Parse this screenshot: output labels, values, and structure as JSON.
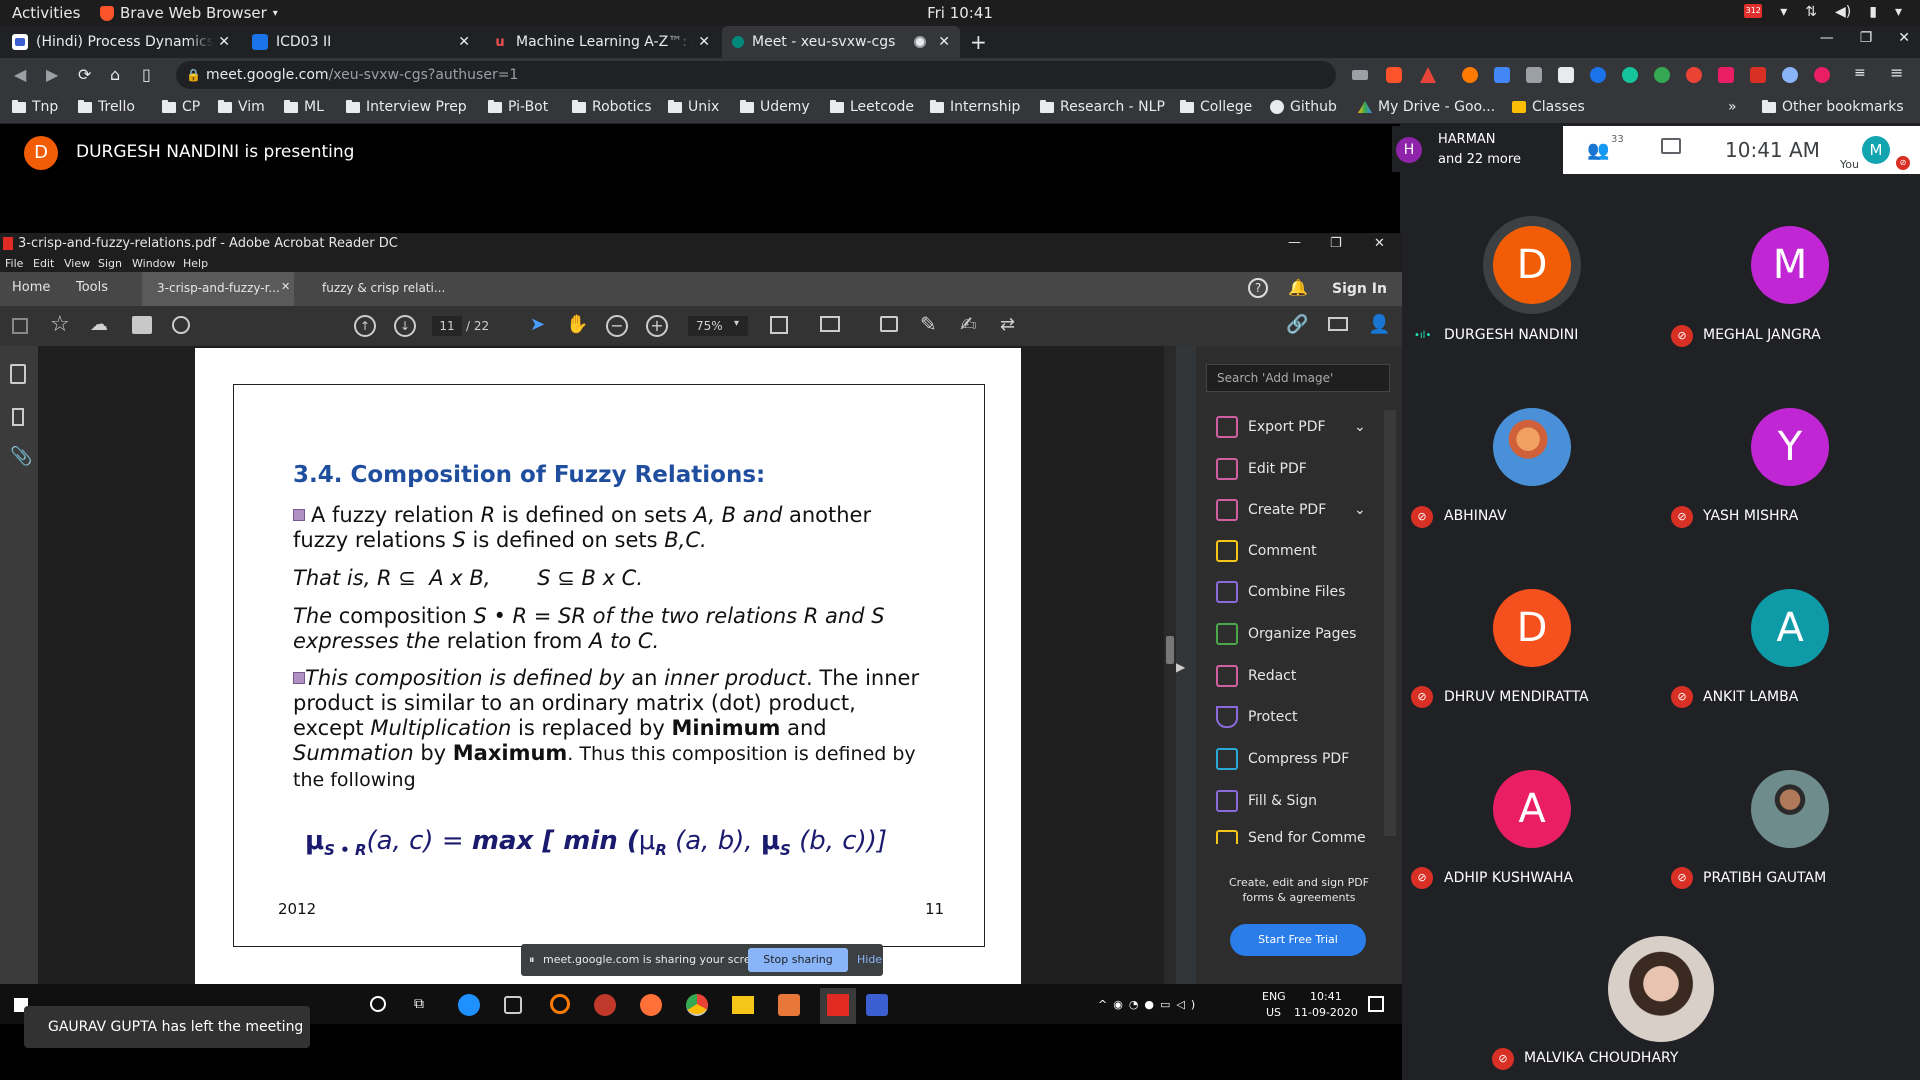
{
  "gnome": {
    "activities": "Activities",
    "app_name": "Brave Web Browser",
    "clock": "Fri 10:41",
    "badge": "312"
  },
  "browser": {
    "tabs": [
      {
        "title": "(Hindi) Process Dynamics a",
        "fav_color": "#2b579a"
      },
      {
        "title": "ICD03 II",
        "fav_color": "#1a73e8"
      },
      {
        "title": "Machine Learning A-Z™: Ha",
        "fav_color": "#a435f0"
      },
      {
        "title": "Meet - xeu-svxw-cgs",
        "fav_color": "#00897b"
      }
    ],
    "new_tab": "+",
    "url_host": "meet.google.com",
    "url_path": "/xeu-svxw-cgs?authuser=1",
    "bookmarks": [
      "Tnp",
      "Trello",
      "CP",
      "Vim",
      "ML",
      "Interview Prep",
      "Pi-Bot",
      "Robotics",
      "Unix",
      "Udemy",
      "Leetcode",
      "Internship",
      "Research - NLP",
      "College",
      "Github",
      "My Drive - Goo...",
      "Classes"
    ],
    "other_bookmarks": "Other bookmarks",
    "more": "»"
  },
  "meet": {
    "presenter_initial": "D",
    "presenting_text": "DURGESH NANDINI is presenting",
    "harman_initial": "H",
    "harman_line1": "HARMAN",
    "harman_line2": "and 22 more",
    "people_count": "33",
    "clock": "10:41  AM",
    "you_initial": "M",
    "you_label": "You",
    "toast": "GAURAV GUPTA has left the meeting"
  },
  "participants": [
    {
      "initial": "D",
      "name": "DURGESH NANDINI",
      "color": "#f25c05",
      "muted": false,
      "speaking": true
    },
    {
      "initial": "M",
      "name": "MEGHAL JANGRA",
      "color": "#c026d3",
      "muted": true
    },
    {
      "initial": "",
      "name": "ABHINAV",
      "color": "#4a90d9",
      "muted": true
    },
    {
      "initial": "Y",
      "name": "YASH MISHRA",
      "color": "#c026d3",
      "muted": true
    },
    {
      "initial": "D",
      "name": "DHRUV MENDIRATTA",
      "color": "#f4511e",
      "muted": true
    },
    {
      "initial": "A",
      "name": "ANKIT LAMBA",
      "color": "#0f9aa8",
      "muted": true
    },
    {
      "initial": "A",
      "name": "ADHIP KUSHWAHA",
      "color": "#e91e63",
      "muted": true
    },
    {
      "initial": "",
      "name": "PRATIBH GAUTAM",
      "color": "#7a8b8c",
      "muted": true
    },
    {
      "initial": "",
      "name": "MALVIKA CHOUDHARY",
      "color": "#c8a89a",
      "muted": true
    }
  ],
  "acrobat": {
    "title": "3-crisp-and-fuzzy-relations.pdf - Adobe Acrobat Reader DC",
    "menu": [
      "File",
      "Edit",
      "View",
      "Sign",
      "Window",
      "Help"
    ],
    "tabs": [
      "Home",
      "Tools",
      "3-crisp-and-fuzzy-r...",
      "fuzzy & crisp relati..."
    ],
    "sign_in": "Sign In",
    "page_current": "11",
    "page_total": "/ 22",
    "zoom": "75%",
    "search_placeholder": "Search 'Add Image'",
    "tools": [
      "Export PDF",
      "Edit PDF",
      "Create PDF",
      "Comment",
      "Combine Files",
      "Organize Pages",
      "Redact",
      "Protect",
      "Compress PDF",
      "Fill & Sign",
      "Send for Comme"
    ],
    "promo": "Create, edit and sign PDF forms & agreements",
    "trial": "Start Free Trial"
  },
  "slide": {
    "heading": "3.4. Composition of Fuzzy Relations:",
    "p1a": "A fuzzy relation ",
    "p1b": "R",
    "p1c": " is defined on sets ",
    "p1d": "A, B and",
    "p1e": " another",
    "p1f": "fuzzy relations ",
    "p1g": "S",
    "p1h": " is defined on sets ",
    "p1i": "B,C.",
    "p2": "That is, R ⊆  A x B,       S ⊆ B x C.",
    "p3a": "The",
    "p3b": " composition ",
    "p3c": "S • R = SR of the two relations R and S",
    "p3d": "expresses the",
    "p3e": " relation from ",
    "p3f": "A to C.",
    "p4a": "This composition is defined by",
    "p4b": " an ",
    "p4c": "inner product",
    "p4d": ". The inner",
    "p4e": "product is similar to an ordinary matrix (dot) product,",
    "p4f": "except ",
    "p4g": "Multiplication",
    "p4h": " is replaced by ",
    "p4i": "Minimum",
    "p4j": " and",
    "p4k": "Summation",
    "p4l": " by ",
    "p4m": "Maximum",
    "p4n": ". Thus this composition is defined by",
    "p4o": "the following",
    "formula": "μ S • R (a, c) = max [ min (μR (a, b), μS (b, c))]",
    "f_mu": "μ",
    "f_sub1": "S • R",
    "f_ac": "(a, c) = ",
    "f_max": "max [ min (",
    "f_mu2": "μ",
    "f_subR": "R",
    "f_ab": " (a, b), ",
    "f_mu3": "μ",
    "f_subS": "S",
    "f_bc": " (b, c))]",
    "year": "2012",
    "page": "11"
  },
  "share": {
    "text": "meet.google.com is sharing your screen.",
    "stop": "Stop sharing",
    "hide": "Hide"
  },
  "taskbar": {
    "lang1": "ENG",
    "lang2": "US",
    "time": "10:41",
    "date": "11-09-2020"
  }
}
